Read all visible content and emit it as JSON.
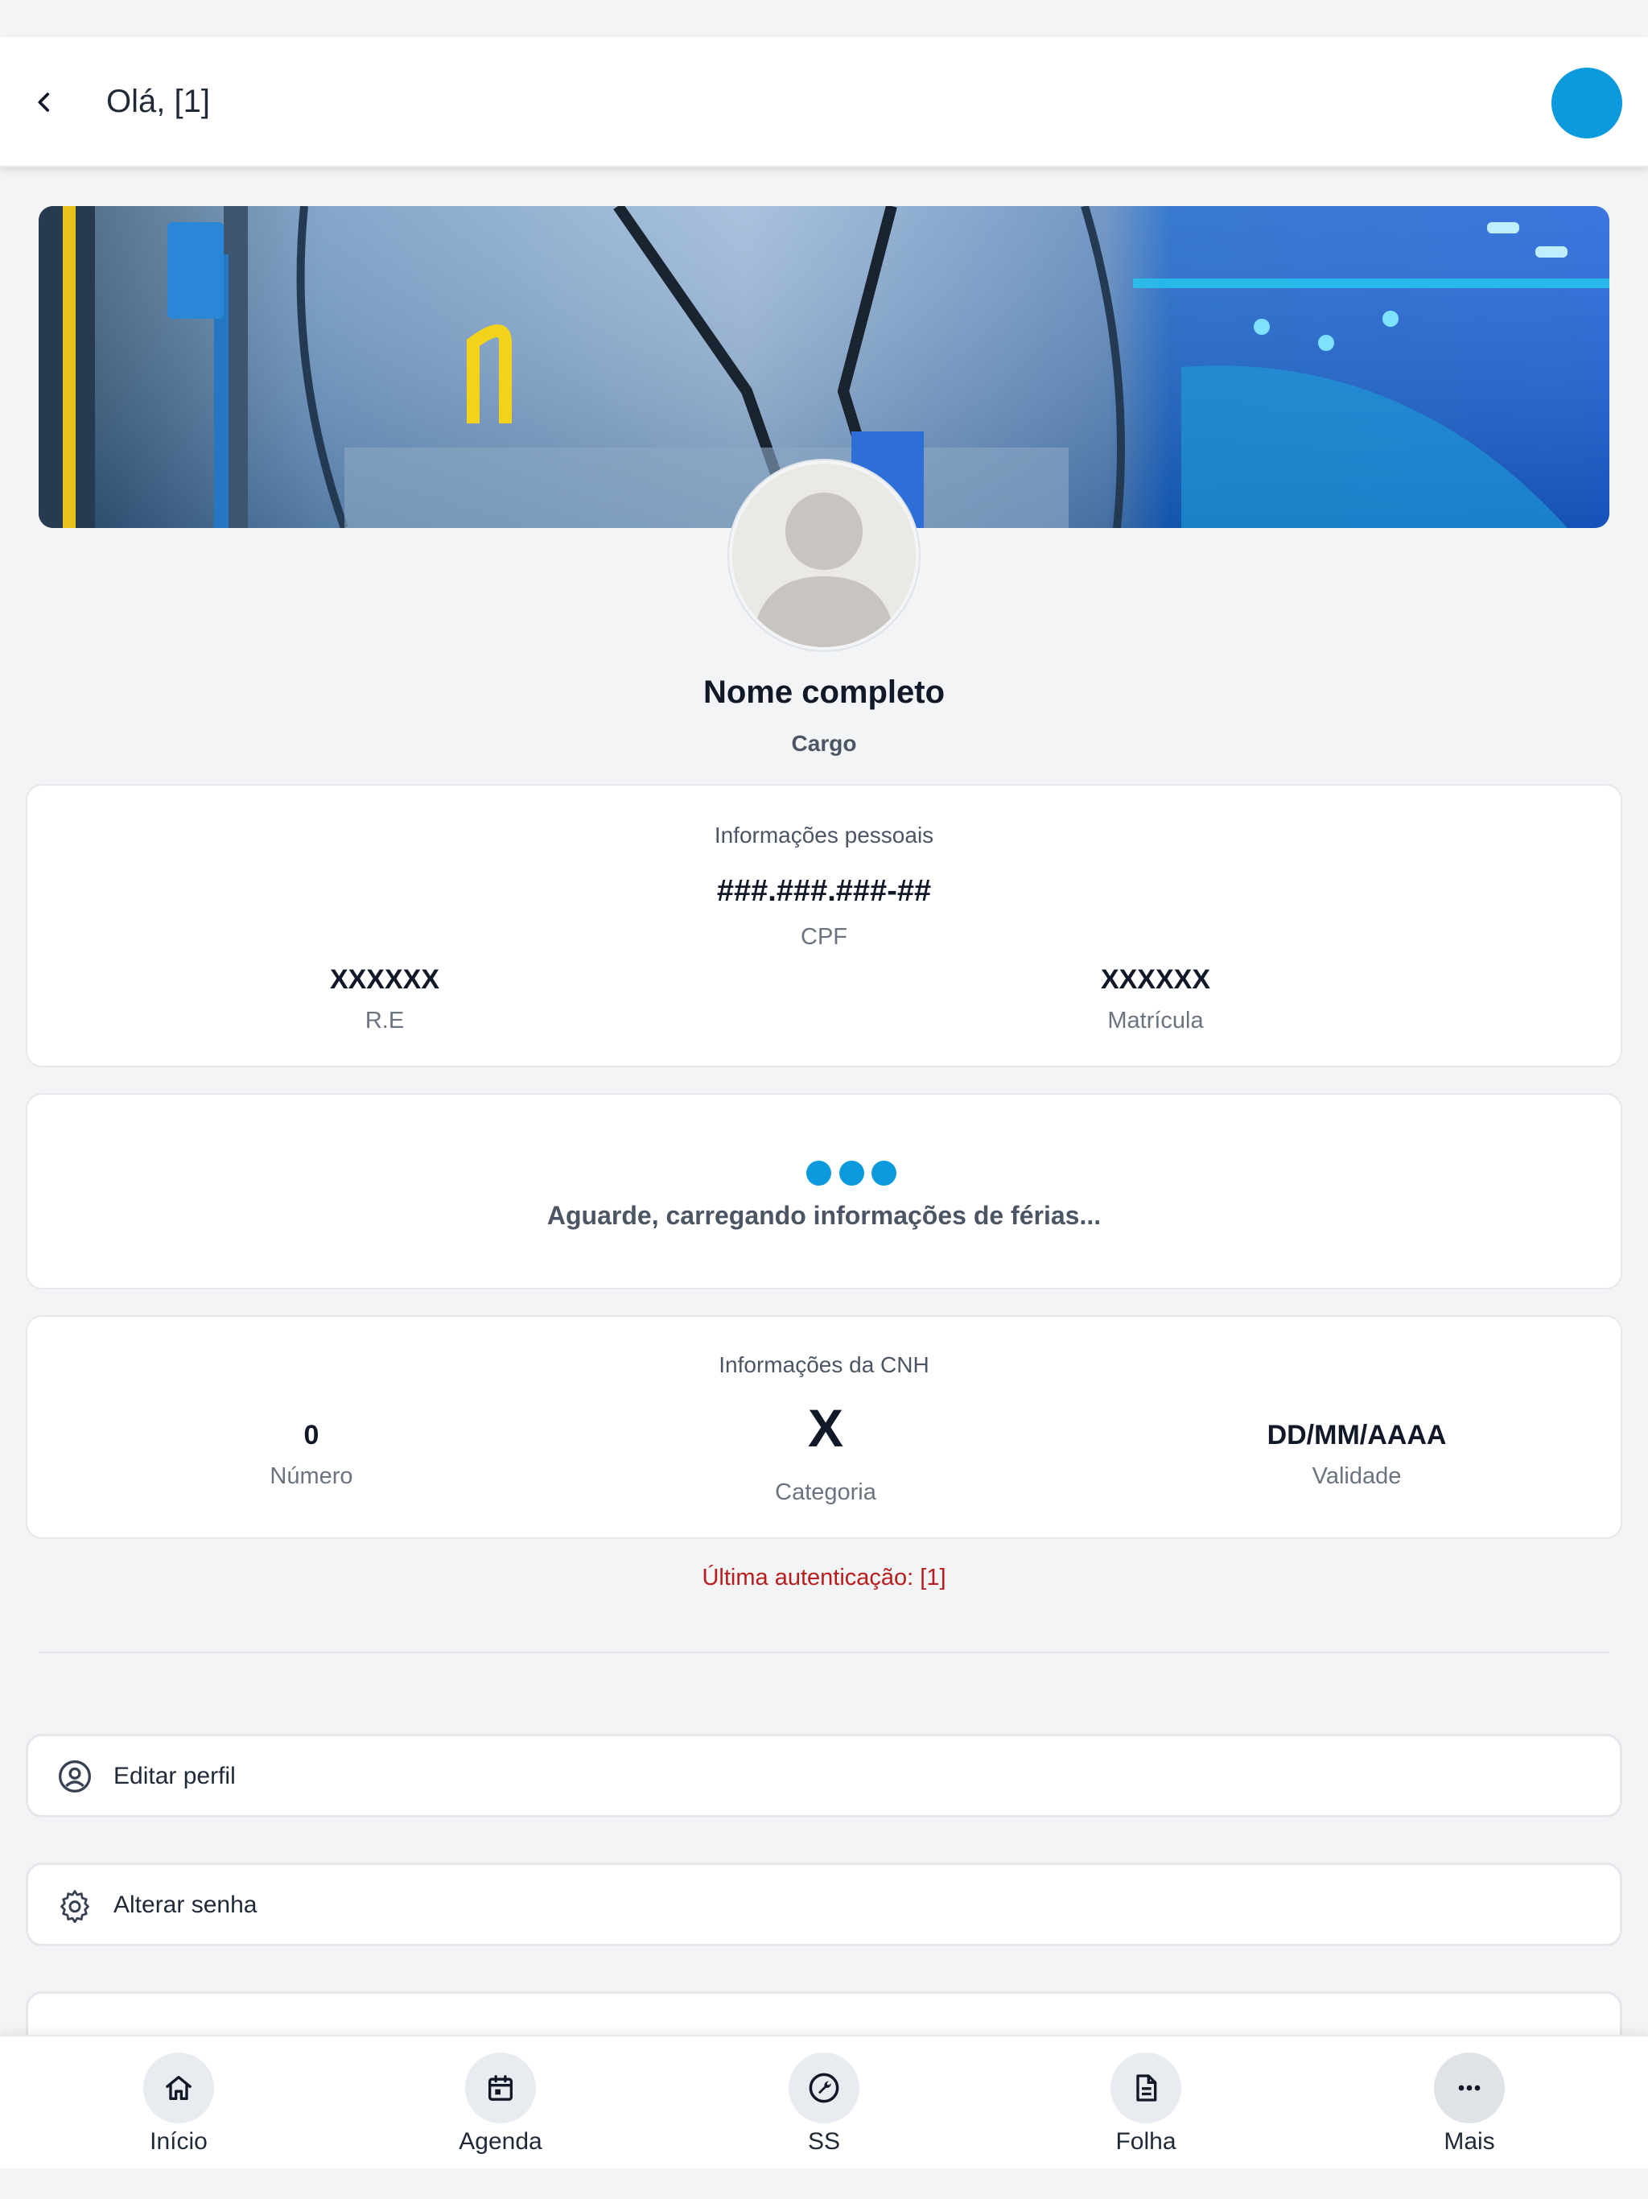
{
  "header": {
    "title": "Olá, [1]",
    "accent_color": "#0b9ade"
  },
  "profile": {
    "name": "Nome completo",
    "role": "Cargo"
  },
  "personal_info": {
    "label": "Informações pessoais",
    "cpf_value": "###.###.###-##",
    "cpf_caption": "CPF",
    "re_value": "XXXXXX",
    "re_caption": "R.E",
    "matricula_value": "XXXXXX",
    "matricula_caption": "Matrícula"
  },
  "vacation": {
    "loading_text": "Aguarde, carregando informações de férias..."
  },
  "cnh": {
    "label": "Informações da CNH",
    "numero_value": "0",
    "numero_caption": "Número",
    "categoria_value": "X",
    "categoria_caption": "Categoria",
    "validade_value": "DD/MM/AAAA",
    "validade_caption": "Validade"
  },
  "last_auth": "Última autenticação: [1]",
  "menu": {
    "edit_profile": "Editar perfil",
    "change_password": "Alterar senha"
  },
  "bottom_nav": {
    "items": [
      {
        "label": "Início",
        "icon": "home-icon"
      },
      {
        "label": "Agenda",
        "icon": "calendar-icon"
      },
      {
        "label": "SS",
        "icon": "wrench-icon"
      },
      {
        "label": "Folha",
        "icon": "document-icon"
      },
      {
        "label": "Mais",
        "icon": "more-icon"
      }
    ]
  }
}
